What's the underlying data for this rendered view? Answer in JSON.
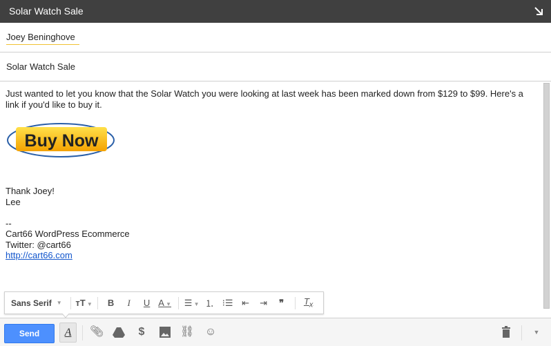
{
  "window": {
    "title": "Solar Watch Sale",
    "popout_icon": "popout-arrow-icon"
  },
  "to": {
    "recipient": "Joey Beninghove"
  },
  "subject": {
    "value": "Solar Watch Sale"
  },
  "body": {
    "paragraph": "Just wanted to let you know that the Solar Watch you were looking at last week has been marked down from $129 to $99. Here's a link if you'd like to buy it.",
    "buy_button_text": "Buy Now",
    "closing": "Thank Joey!",
    "name": "Lee",
    "sig_dash": "--",
    "sig_company": "Cart66 WordPress Ecommerce",
    "sig_twitter": "Twitter: @cart66",
    "sig_link": "http://cart66.com"
  },
  "format_toolbar": {
    "font": "Sans Serif",
    "buttons": [
      "size",
      "bold",
      "italic",
      "underline",
      "text-color",
      "align",
      "numbered-list",
      "bulleted-list",
      "indent-less",
      "indent-more",
      "quote",
      "remove-formatting"
    ]
  },
  "bottom": {
    "send_label": "Send",
    "format_label": "A"
  }
}
